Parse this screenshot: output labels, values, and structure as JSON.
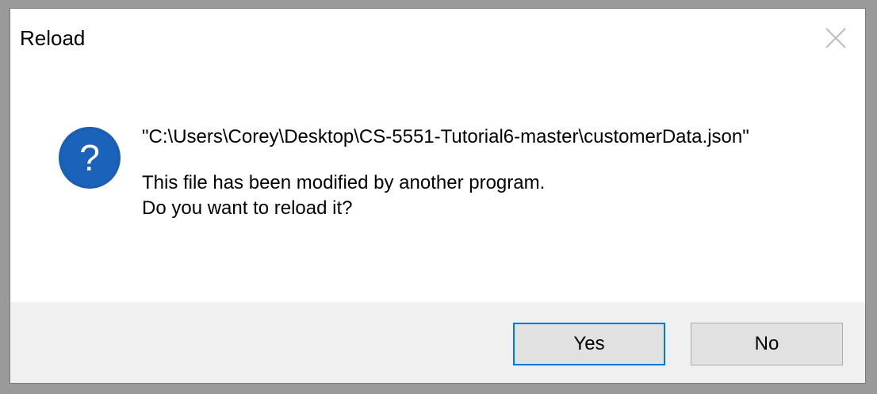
{
  "window": {
    "title": "Reload"
  },
  "message": {
    "file_path": "\"C:\\Users\\Corey\\Desktop\\CS-5551-Tutorial6-master\\customerData.json\"",
    "line1": "This file has been modified by another program.",
    "line2": "Do you want to reload it?"
  },
  "buttons": {
    "yes_label": "Yes",
    "no_label": "No"
  },
  "icons": {
    "question": "question-icon",
    "close": "close-icon"
  },
  "colors": {
    "icon_blue": "#1a5fb4",
    "focus_border": "#0078d7",
    "footer_bg": "#f0f0f0"
  }
}
